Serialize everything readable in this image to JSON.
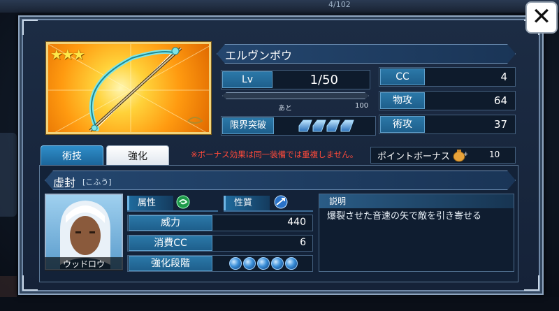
{
  "background": {
    "top_text": "4/102"
  },
  "dialog": {
    "close_label": "✕",
    "item": {
      "stars": "★★★",
      "name": "エルヴンボウ"
    },
    "level": {
      "label": "Lv",
      "value": "1/50",
      "next_label": "あと",
      "next_value": "100",
      "exp_progress": 0
    },
    "limit_break": {
      "label": "限界突破",
      "count": 4
    },
    "stats": [
      {
        "label": "CC",
        "value": "4"
      },
      {
        "label": "物攻",
        "value": "64"
      },
      {
        "label": "術攻",
        "value": "37"
      }
    ],
    "tabs": [
      {
        "label": "術技",
        "active": true
      },
      {
        "label": "強化",
        "active": false
      }
    ],
    "notice": "※ボーナス効果は同一装備では重複しません。",
    "point_bonus": {
      "label": "ポイントボーナス",
      "value": "10",
      "icon": "coin-bag-icon"
    },
    "skill": {
      "name": "虚封",
      "reading": "[こふう]",
      "character": "ウッドロウ",
      "attribute_label": "属性",
      "attribute_icon": "wind-orb-icon",
      "nature_label": "性質",
      "nature_icon": "pierce-orb-icon",
      "rows": [
        {
          "label": "威力",
          "value": "440"
        },
        {
          "label": "消費CC",
          "value": "6"
        },
        {
          "label": "強化段階",
          "value": ""
        }
      ],
      "enhance_stage_count": 5,
      "description_label": "説明",
      "description": "爆裂させた音速の矢で敵を引き寄せる"
    }
  },
  "colors": {
    "accent": "#2b78a8",
    "notice": "#ff4a3a",
    "star": "#ffe84a"
  }
}
